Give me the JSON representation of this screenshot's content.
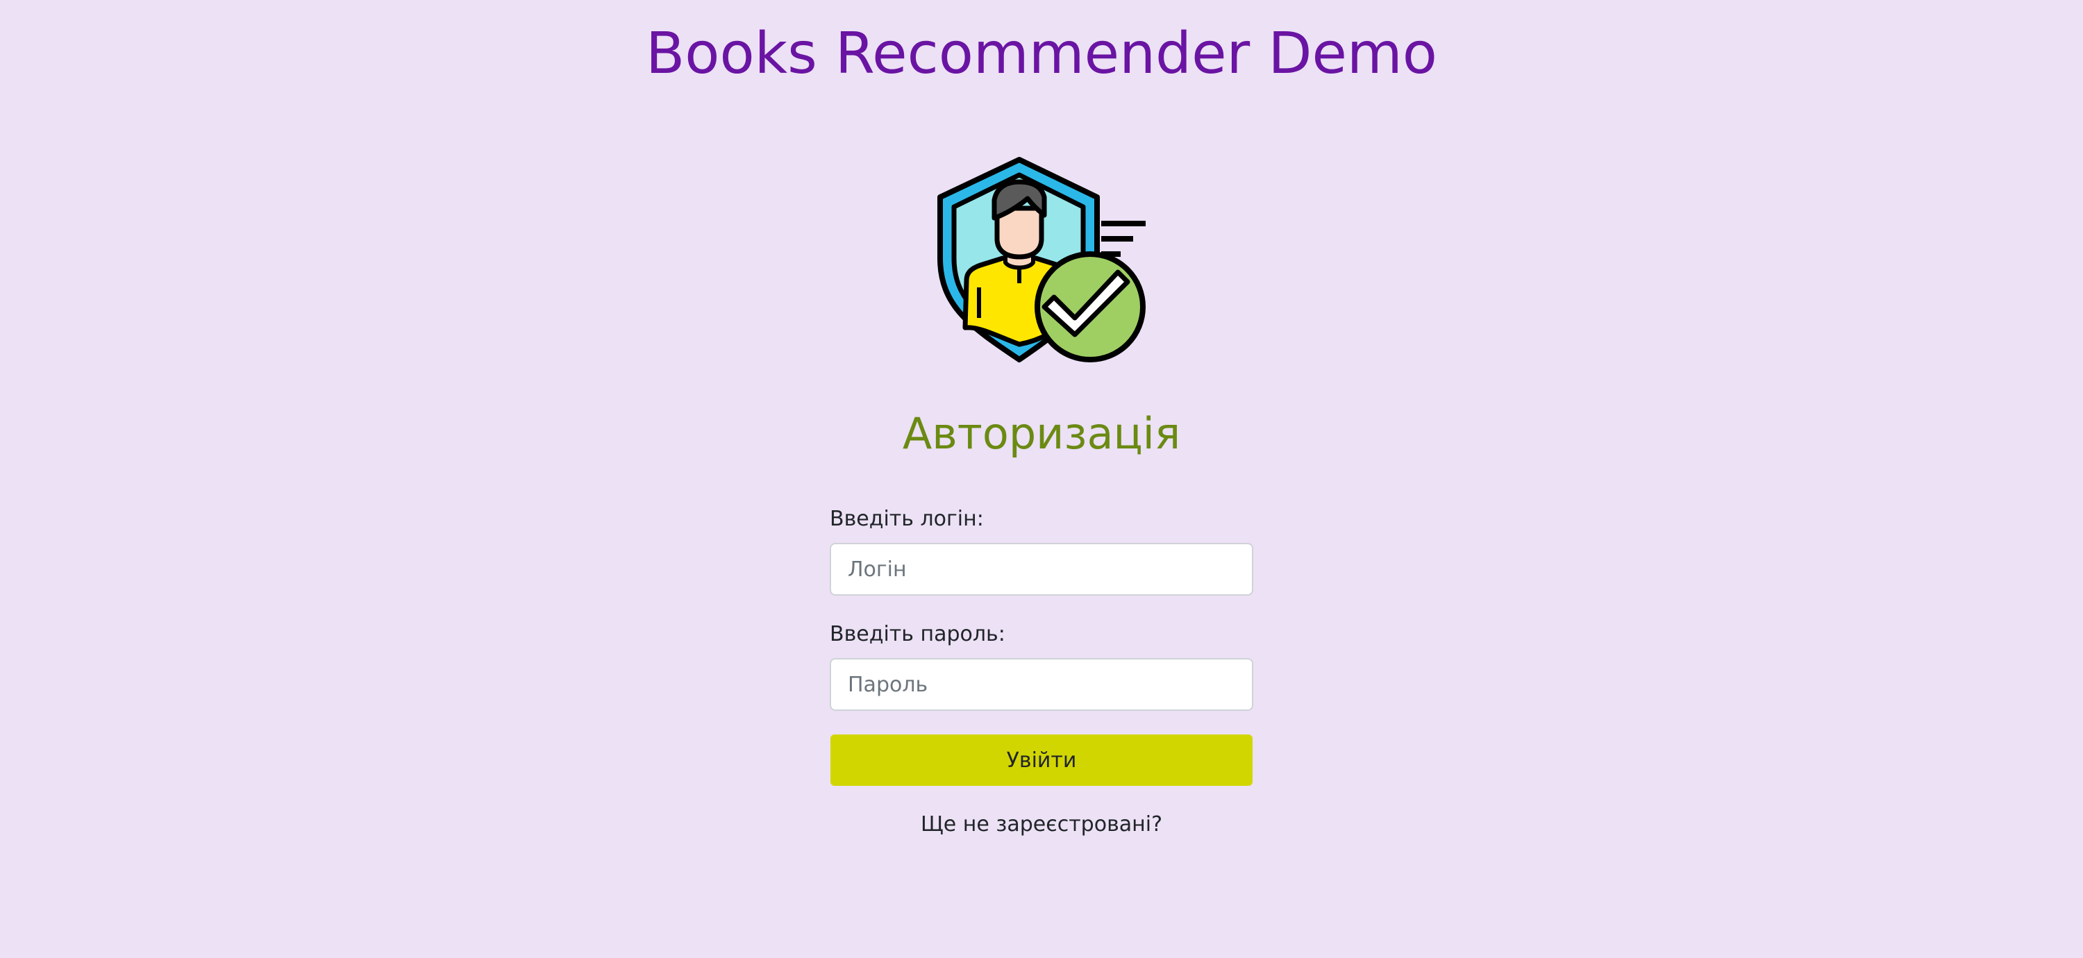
{
  "header": {
    "title": "Books Recommender Demo"
  },
  "illustration": {
    "icon": "user-shield-check-icon",
    "colors": {
      "shield_outer": "#2bb8e8",
      "shield_inner": "#96e6ea",
      "shirt": "#ffe600",
      "check_badge": "#9fcf63"
    }
  },
  "login": {
    "heading": "Авторизація",
    "login_label": "Введіть логін:",
    "login_placeholder": "Логін",
    "password_label": "Введіть пароль:",
    "password_placeholder": "Пароль",
    "submit_label": "Увійти",
    "register_link": "Ще не зареєстровані?"
  },
  "colors": {
    "background": "#ece1f5",
    "title": "#6a14a3",
    "heading": "#6b8a12",
    "button": "#d2d600"
  }
}
